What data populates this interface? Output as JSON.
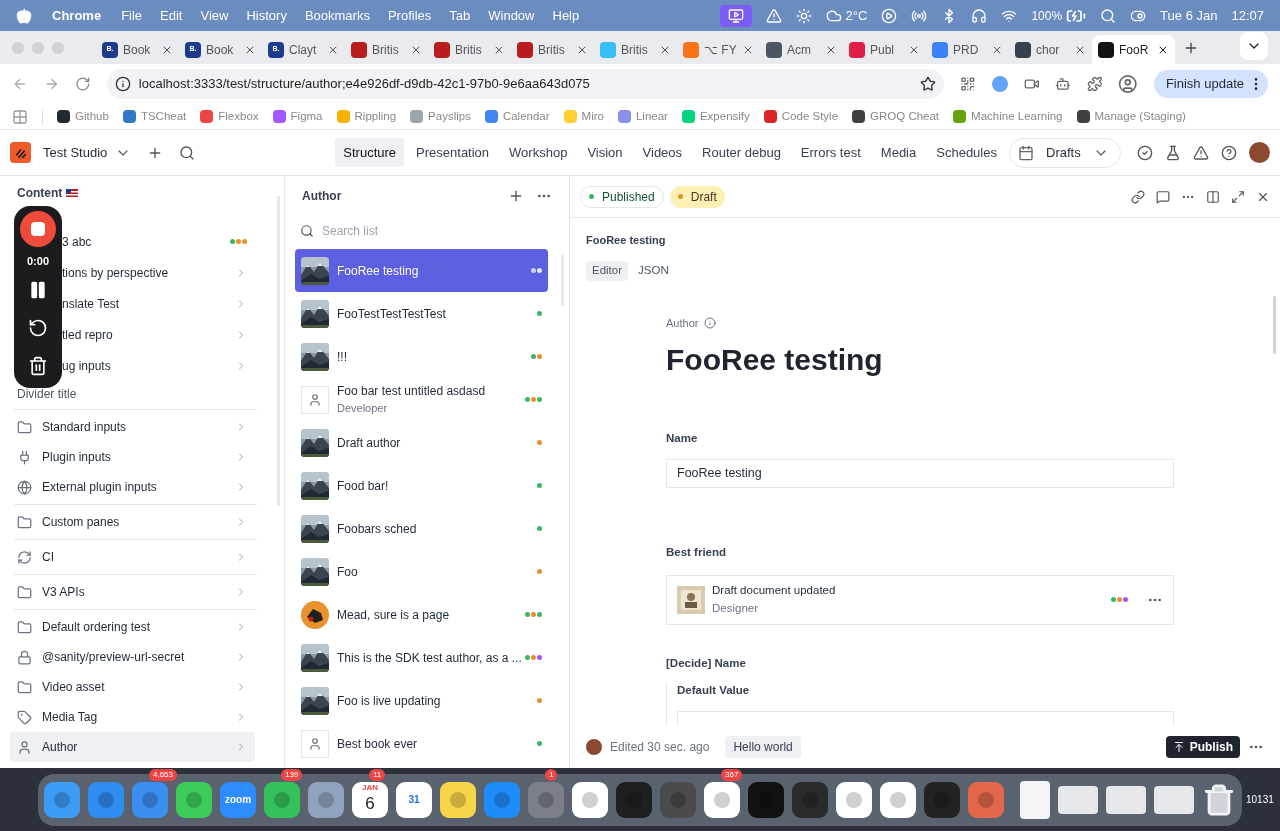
{
  "menubar": {
    "app": "Chrome",
    "menus": [
      "File",
      "Edit",
      "View",
      "History",
      "Bookmarks",
      "Profiles",
      "Tab",
      "Window",
      "Help"
    ],
    "weather": "2°C",
    "battery": "100%",
    "date": "Tue 6 Jan",
    "time": "12:07"
  },
  "browser_tabs": [
    {
      "title": "Book",
      "favicon_text": "B.",
      "color": "#1e3a8a",
      "selected": false
    },
    {
      "title": "Book",
      "favicon_text": "B.",
      "color": "#1e3a8a",
      "selected": false
    },
    {
      "title": "Clayt",
      "favicon_text": "B.",
      "color": "#1e3a8a",
      "selected": false
    },
    {
      "title": "Britis",
      "color": "#b91c1c",
      "selected": false
    },
    {
      "title": "Britis",
      "color": "#b91c1c",
      "selected": false
    },
    {
      "title": "Britis",
      "color": "#b91c1c",
      "selected": false
    },
    {
      "title": "Britis",
      "color": "#38bdf8",
      "selected": false
    },
    {
      "title": "⌥ FY",
      "color": "#f97316",
      "selected": false
    },
    {
      "title": "Acm",
      "color": "#4b5563",
      "selected": false
    },
    {
      "title": "Publ",
      "color": "#e11d48",
      "selected": false
    },
    {
      "title": "PRD",
      "color": "#3b82f6",
      "selected": false
    },
    {
      "title": "chor",
      "color": "#374151",
      "selected": false
    },
    {
      "title": "FooR",
      "color": "#111111",
      "selected": true
    }
  ],
  "address": {
    "url": "localhost:3333/test/structure/author;e4e926df-d9db-42c1-97b0-9e6aa643d075",
    "update_button": "Finish update"
  },
  "bookmarks": [
    {
      "label": "Github",
      "color": "#24292f"
    },
    {
      "label": "TSCheat",
      "color": "#3178c6"
    },
    {
      "label": "Flexbox",
      "color": "#ef4444"
    },
    {
      "label": "Figma",
      "color": "#a259ff"
    },
    {
      "label": "Rippling",
      "color": "#f5b400"
    },
    {
      "label": "Payslips",
      "color": "#9ca3af"
    },
    {
      "label": "Calendar",
      "color": "#4285f4"
    },
    {
      "label": "Miro",
      "color": "#ffd02f"
    },
    {
      "label": "Linear",
      "color": "#8b8fe8"
    },
    {
      "label": "Expensify",
      "color": "#03d47c"
    },
    {
      "label": "Code Style",
      "color": "#dc2626"
    },
    {
      "label": "GROQ Cheat",
      "color": "#404040"
    },
    {
      "label": "Machine Learning",
      "color": "#65a30d"
    },
    {
      "label": "Manage (Staging)",
      "color": "#404040"
    }
  ],
  "studio": {
    "name": "Test Studio",
    "nav": [
      {
        "label": "Structure",
        "selected": true
      },
      {
        "label": "Presentation",
        "selected": false
      },
      {
        "label": "Workshop",
        "selected": false
      },
      {
        "label": "Vision",
        "selected": false
      },
      {
        "label": "Videos",
        "selected": false
      },
      {
        "label": "Router debug",
        "selected": false
      },
      {
        "label": "Errors test",
        "selected": false
      },
      {
        "label": "Media",
        "selected": false
      },
      {
        "label": "Schedules",
        "selected": false
      }
    ],
    "perspective": "Drafts"
  },
  "recorder": {
    "elapsed": "0:00"
  },
  "sidebar": {
    "title": "Content",
    "items": [
      {
        "kind": "covered",
        "label": "3 abc",
        "selected": false,
        "dots": [
          {
            "color": "#3ab667"
          },
          {
            "color": "#e8912d"
          },
          {
            "color": "#e8912d"
          }
        ]
      },
      {
        "kind": "covered",
        "label": "tions by perspective",
        "selected": false
      },
      {
        "kind": "covered",
        "label": "nslate Test",
        "selected": false
      },
      {
        "kind": "covered",
        "label": "tled repro",
        "selected": false
      },
      {
        "kind": "covered",
        "label": "ug inputs",
        "selected": false
      },
      {
        "kind": "heading",
        "label": "Divider title"
      },
      {
        "kind": "divider"
      },
      {
        "kind": "row",
        "label": "Standard inputs",
        "selected": false
      },
      {
        "kind": "row",
        "label": "Plugin inputs",
        "selected": false
      },
      {
        "kind": "row",
        "label": "External plugin inputs",
        "selected": false
      },
      {
        "kind": "divider"
      },
      {
        "kind": "row",
        "label": "Custom panes",
        "selected": false
      },
      {
        "kind": "divider"
      },
      {
        "kind": "row",
        "label": "CI",
        "selected": false
      },
      {
        "kind": "divider"
      },
      {
        "kind": "row",
        "label": "V3 APIs",
        "selected": false
      },
      {
        "kind": "divider"
      },
      {
        "kind": "row",
        "label": "Default ordering test",
        "selected": false
      },
      {
        "kind": "row",
        "label": "@sanity/preview-url-secret",
        "selected": false
      },
      {
        "kind": "row",
        "label": "Video asset",
        "selected": false
      },
      {
        "kind": "row",
        "label": "Media Tag",
        "selected": false
      },
      {
        "kind": "row",
        "label": "Author",
        "selected": true
      }
    ]
  },
  "author_list": {
    "title": "Author",
    "search_placeholder": "Search list",
    "items": [
      {
        "kind": "picture",
        "title": "FooRee testing",
        "selected": true,
        "dots": [
          {
            "color": "#c7d2fe"
          },
          {
            "color": "#e0e7ff"
          }
        ]
      },
      {
        "kind": "picture",
        "title": "FooTestTestTestTest",
        "selected": false,
        "dots": [
          {
            "color": "#3ab667"
          }
        ]
      },
      {
        "kind": "picture",
        "title": "!!!",
        "selected": false,
        "dots": [
          {
            "color": "#3ab667"
          },
          {
            "color": "#e8912d"
          }
        ]
      },
      {
        "kind": "person",
        "title": "Foo bar test untitled asdasd",
        "subtitle": "Developer",
        "selected": false,
        "dots": [
          {
            "color": "#3ab667"
          },
          {
            "color": "#e8912d"
          },
          {
            "color": "#3ab667"
          }
        ]
      },
      {
        "kind": "picture",
        "title": "Draft author",
        "selected": false,
        "dots": [
          {
            "color": "#e8912d"
          }
        ]
      },
      {
        "kind": "picture",
        "title": "Food bar!",
        "selected": false,
        "dots": [
          {
            "color": "#3ab667"
          }
        ]
      },
      {
        "kind": "picture",
        "title": "Foobars sched",
        "selected": false,
        "dots": [
          {
            "color": "#3ab667"
          }
        ]
      },
      {
        "kind": "picture",
        "title": "Foo",
        "selected": false,
        "dots": [
          {
            "color": "#e8912d"
          }
        ]
      },
      {
        "kind": "avatar",
        "title": "Mead, sure is a page",
        "selected": false,
        "dots": [
          {
            "color": "#3ab667"
          },
          {
            "color": "#e8912d"
          },
          {
            "color": "#3ab667"
          }
        ]
      },
      {
        "kind": "picture",
        "title": "This is the SDK test author, as a ...",
        "selected": false,
        "dots": [
          {
            "color": "#3ab667"
          },
          {
            "color": "#e8912d"
          },
          {
            "color": "#a855f7"
          }
        ]
      },
      {
        "kind": "picture",
        "title": "Foo is live updating",
        "selected": false,
        "dots": [
          {
            "color": "#e8912d"
          }
        ]
      },
      {
        "kind": "person",
        "title": "Best book ever",
        "selected": false,
        "dots": [
          {
            "color": "#3ab667"
          }
        ]
      }
    ]
  },
  "document": {
    "versions": [
      {
        "label": "Published",
        "color": "#3ab667",
        "selected": false
      },
      {
        "label": "Draft",
        "color": "#d49a1a",
        "selected": true
      }
    ],
    "title": "FooRee testing",
    "view_tabs": [
      {
        "label": "Editor",
        "selected": true
      },
      {
        "label": "JSON",
        "selected": false
      }
    ],
    "type_label": "Author",
    "heading": "FooRee testing",
    "fields": [
      {
        "kind": "text",
        "label": "Name",
        "value": "FooRee testing"
      },
      {
        "kind": "reference",
        "label": "Best friend",
        "title": "Draft document updated",
        "subtitle": "Designer",
        "dots": [
          {
            "color": "#3ab667"
          },
          {
            "color": "#e8912d"
          },
          {
            "color": "#a855f7"
          }
        ]
      },
      {
        "kind": "object",
        "label": "[Decide] Name",
        "inner_label": "Default Value"
      }
    ],
    "footer": {
      "edited": "Edited 30 sec. ago",
      "release": "Hello world",
      "publish": "Publish"
    }
  },
  "dock": [
    {
      "kind": "app",
      "color": "#3b9cf5"
    },
    {
      "kind": "app",
      "color": "#2f8cf0"
    },
    {
      "kind": "app",
      "color": "#3b8ff0",
      "badge": "4,653"
    },
    {
      "kind": "app",
      "color": "#3dcc5a"
    },
    {
      "kind": "app",
      "color": "#2d8cff",
      "label": "zoom"
    },
    {
      "kind": "app",
      "color": "#36c25b",
      "badge": "139"
    },
    {
      "kind": "app",
      "color": "#8fa3bf"
    },
    {
      "kind": "calendar",
      "color": "#ffffff",
      "month": "JAN",
      "day": "6",
      "badge": "11"
    },
    {
      "kind": "app",
      "color": "#ffffff",
      "label": "31"
    },
    {
      "kind": "app",
      "color": "#f7d54a"
    },
    {
      "kind": "app",
      "color": "#1d8cf8"
    },
    {
      "kind": "app",
      "color": "#7b7f87",
      "badge": "1"
    },
    {
      "kind": "app",
      "color": "#ffffff"
    },
    {
      "kind": "app",
      "color": "#1f1f1f"
    },
    {
      "kind": "app",
      "color": "#4b4b4b"
    },
    {
      "kind": "app",
      "color": "#ffffff",
      "badge": "367"
    },
    {
      "kind": "app",
      "color": "#121212"
    },
    {
      "kind": "app",
      "color": "#2a2a2a"
    },
    {
      "kind": "app",
      "color": "#ffffff"
    },
    {
      "kind": "app",
      "color": "#ffffff"
    },
    {
      "kind": "app",
      "color": "#222222"
    },
    {
      "kind": "app",
      "color": "#e2674a"
    },
    {
      "kind": "separator"
    },
    {
      "kind": "file",
      "color": "#f3f4f6"
    },
    {
      "kind": "window",
      "color": "#e5e7eb"
    },
    {
      "kind": "window",
      "color": "#e5e7eb"
    },
    {
      "kind": "window",
      "color": "#e5e7eb"
    },
    {
      "kind": "trash",
      "color": "#d1d5db"
    }
  ],
  "dock_edge_text": "10131"
}
